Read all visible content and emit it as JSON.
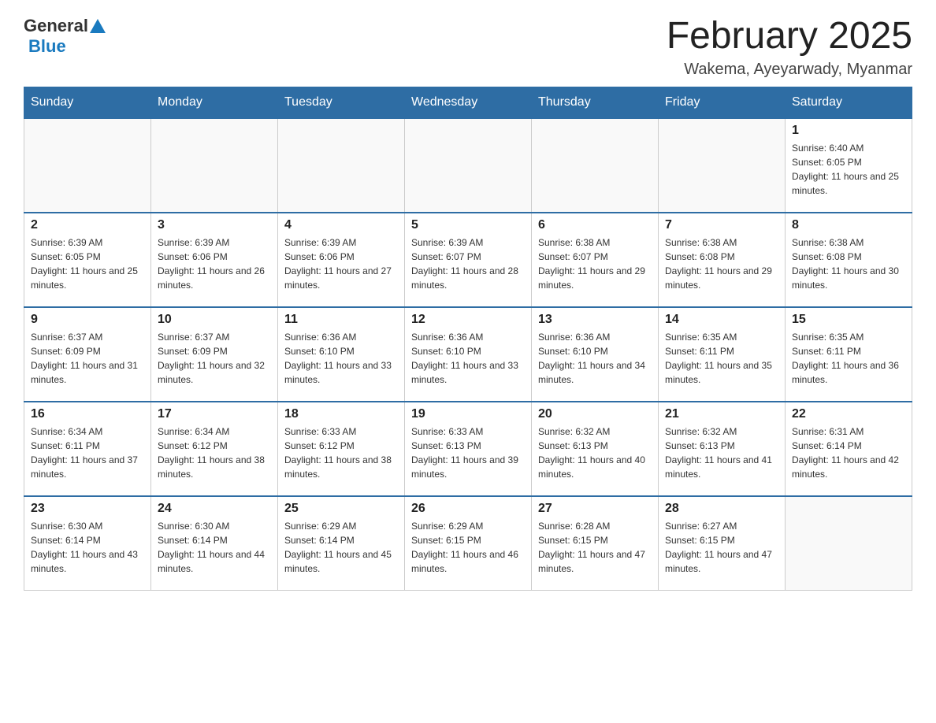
{
  "header": {
    "logo": {
      "general": "General",
      "blue": "Blue"
    },
    "title": "February 2025",
    "subtitle": "Wakema, Ayeyarwady, Myanmar"
  },
  "calendar": {
    "weekdays": [
      "Sunday",
      "Monday",
      "Tuesday",
      "Wednesday",
      "Thursday",
      "Friday",
      "Saturday"
    ],
    "weeks": [
      [
        {
          "day": "",
          "info": ""
        },
        {
          "day": "",
          "info": ""
        },
        {
          "day": "",
          "info": ""
        },
        {
          "day": "",
          "info": ""
        },
        {
          "day": "",
          "info": ""
        },
        {
          "day": "",
          "info": ""
        },
        {
          "day": "1",
          "info": "Sunrise: 6:40 AM\nSunset: 6:05 PM\nDaylight: 11 hours and 25 minutes."
        }
      ],
      [
        {
          "day": "2",
          "info": "Sunrise: 6:39 AM\nSunset: 6:05 PM\nDaylight: 11 hours and 25 minutes."
        },
        {
          "day": "3",
          "info": "Sunrise: 6:39 AM\nSunset: 6:06 PM\nDaylight: 11 hours and 26 minutes."
        },
        {
          "day": "4",
          "info": "Sunrise: 6:39 AM\nSunset: 6:06 PM\nDaylight: 11 hours and 27 minutes."
        },
        {
          "day": "5",
          "info": "Sunrise: 6:39 AM\nSunset: 6:07 PM\nDaylight: 11 hours and 28 minutes."
        },
        {
          "day": "6",
          "info": "Sunrise: 6:38 AM\nSunset: 6:07 PM\nDaylight: 11 hours and 29 minutes."
        },
        {
          "day": "7",
          "info": "Sunrise: 6:38 AM\nSunset: 6:08 PM\nDaylight: 11 hours and 29 minutes."
        },
        {
          "day": "8",
          "info": "Sunrise: 6:38 AM\nSunset: 6:08 PM\nDaylight: 11 hours and 30 minutes."
        }
      ],
      [
        {
          "day": "9",
          "info": "Sunrise: 6:37 AM\nSunset: 6:09 PM\nDaylight: 11 hours and 31 minutes."
        },
        {
          "day": "10",
          "info": "Sunrise: 6:37 AM\nSunset: 6:09 PM\nDaylight: 11 hours and 32 minutes."
        },
        {
          "day": "11",
          "info": "Sunrise: 6:36 AM\nSunset: 6:10 PM\nDaylight: 11 hours and 33 minutes."
        },
        {
          "day": "12",
          "info": "Sunrise: 6:36 AM\nSunset: 6:10 PM\nDaylight: 11 hours and 33 minutes."
        },
        {
          "day": "13",
          "info": "Sunrise: 6:36 AM\nSunset: 6:10 PM\nDaylight: 11 hours and 34 minutes."
        },
        {
          "day": "14",
          "info": "Sunrise: 6:35 AM\nSunset: 6:11 PM\nDaylight: 11 hours and 35 minutes."
        },
        {
          "day": "15",
          "info": "Sunrise: 6:35 AM\nSunset: 6:11 PM\nDaylight: 11 hours and 36 minutes."
        }
      ],
      [
        {
          "day": "16",
          "info": "Sunrise: 6:34 AM\nSunset: 6:11 PM\nDaylight: 11 hours and 37 minutes."
        },
        {
          "day": "17",
          "info": "Sunrise: 6:34 AM\nSunset: 6:12 PM\nDaylight: 11 hours and 38 minutes."
        },
        {
          "day": "18",
          "info": "Sunrise: 6:33 AM\nSunset: 6:12 PM\nDaylight: 11 hours and 38 minutes."
        },
        {
          "day": "19",
          "info": "Sunrise: 6:33 AM\nSunset: 6:13 PM\nDaylight: 11 hours and 39 minutes."
        },
        {
          "day": "20",
          "info": "Sunrise: 6:32 AM\nSunset: 6:13 PM\nDaylight: 11 hours and 40 minutes."
        },
        {
          "day": "21",
          "info": "Sunrise: 6:32 AM\nSunset: 6:13 PM\nDaylight: 11 hours and 41 minutes."
        },
        {
          "day": "22",
          "info": "Sunrise: 6:31 AM\nSunset: 6:14 PM\nDaylight: 11 hours and 42 minutes."
        }
      ],
      [
        {
          "day": "23",
          "info": "Sunrise: 6:30 AM\nSunset: 6:14 PM\nDaylight: 11 hours and 43 minutes."
        },
        {
          "day": "24",
          "info": "Sunrise: 6:30 AM\nSunset: 6:14 PM\nDaylight: 11 hours and 44 minutes."
        },
        {
          "day": "25",
          "info": "Sunrise: 6:29 AM\nSunset: 6:14 PM\nDaylight: 11 hours and 45 minutes."
        },
        {
          "day": "26",
          "info": "Sunrise: 6:29 AM\nSunset: 6:15 PM\nDaylight: 11 hours and 46 minutes."
        },
        {
          "day": "27",
          "info": "Sunrise: 6:28 AM\nSunset: 6:15 PM\nDaylight: 11 hours and 47 minutes."
        },
        {
          "day": "28",
          "info": "Sunrise: 6:27 AM\nSunset: 6:15 PM\nDaylight: 11 hours and 47 minutes."
        },
        {
          "day": "",
          "info": ""
        }
      ]
    ]
  }
}
